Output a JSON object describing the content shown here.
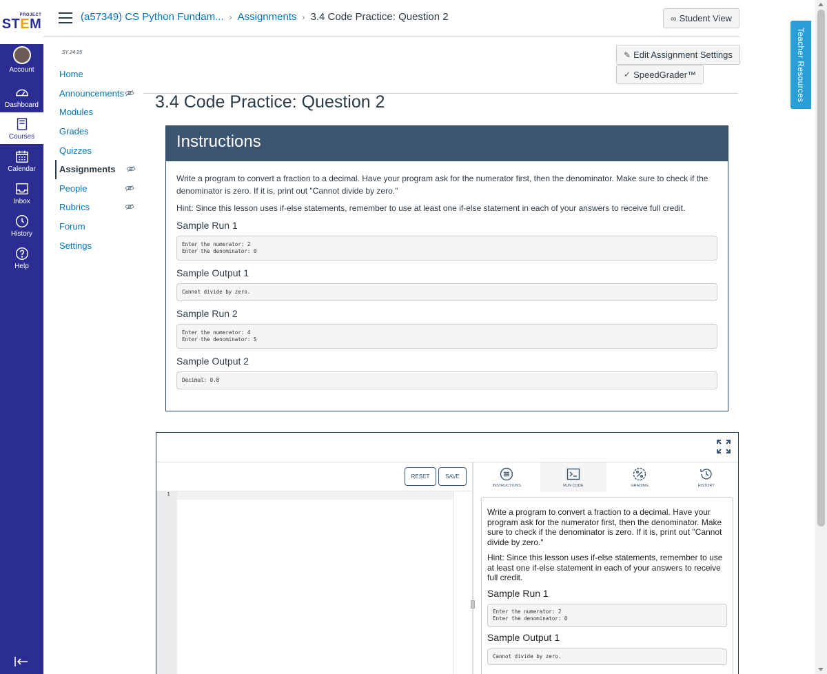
{
  "logo": {
    "line1": "PROJECT",
    "line2_a": "ST",
    "line2_b": "E",
    "line2_c": "M"
  },
  "global_nav": [
    {
      "label": "Account",
      "icon": "avatar"
    },
    {
      "label": "Dashboard",
      "icon": "dashboard-icon"
    },
    {
      "label": "Courses",
      "icon": "courses-icon"
    },
    {
      "label": "Calendar",
      "icon": "calendar-icon"
    },
    {
      "label": "Inbox",
      "icon": "inbox-icon"
    },
    {
      "label": "History",
      "icon": "clock-icon"
    },
    {
      "label": "Help",
      "icon": "help-icon"
    }
  ],
  "breadcrumbs": {
    "course": "(a57349) CS Python Fundam...",
    "section": "Assignments",
    "current": "3.4 Code Practice: Question 2"
  },
  "buttons": {
    "student_view": "Student View",
    "edit_settings": "Edit Assignment Settings",
    "speedgrader": "SpeedGrader™"
  },
  "course_nav": {
    "term": "SY 24-25",
    "items": [
      {
        "label": "Home",
        "hidden_icon": false
      },
      {
        "label": "Announcements",
        "hidden_icon": true
      },
      {
        "label": "Modules",
        "hidden_icon": false
      },
      {
        "label": "Grades",
        "hidden_icon": false
      },
      {
        "label": "Quizzes",
        "hidden_icon": false
      },
      {
        "label": "Assignments",
        "hidden_icon": true,
        "active": true
      },
      {
        "label": "People",
        "hidden_icon": true
      },
      {
        "label": "Rubrics",
        "hidden_icon": true
      },
      {
        "label": "Forum",
        "hidden_icon": false
      },
      {
        "label": "Settings",
        "hidden_icon": false
      }
    ]
  },
  "teacher_resources": "Teacher Resources",
  "page_title": "3.4 Code Practice: Question 2",
  "instructions": {
    "heading": "Instructions",
    "para1": "Write a program to convert a fraction to a decimal. Have your program ask for the numerator first, then the denominator. Make sure to check if the denominator is zero. If it is, print out \"Cannot divide by zero.\"",
    "hint": "Hint: Since this lesson uses if-else statements, remember to use at least one if-else statement in each of your answers to receive full credit.",
    "run1_title": "Sample Run 1",
    "run1_code": "Enter the numerator: 2\nEnter the denominator: 0",
    "out1_title": "Sample Output 1",
    "out1_code": "Cannot divide by zero.",
    "run2_title": "Sample Run 2",
    "run2_code": "Enter the numerator: 4\nEnter the denominator: 5",
    "out2_title": "Sample Output 2",
    "out2_code": "Decimal: 0.8"
  },
  "ide": {
    "reset": "RESET",
    "save": "SAVE",
    "line_number": "1",
    "tabs": [
      "INSTRUCTIONS",
      "RUN CODE",
      "GRADING",
      "HISTORY"
    ],
    "panel_para1": "Write a program to convert a fraction to a decimal. Have your program ask for the numerator first, then the denominator. Make sure to check if the denominator is zero. If it is, print out \"Cannot divide by zero.\"",
    "panel_hint": "Hint: Since this lesson uses if-else statements, remember to use at least one if-else statement in each of your answers to receive full credit.",
    "panel_run1_title": "Sample Run 1",
    "panel_run1_code": "Enter the numerator: 2\nEnter the denominator: 0",
    "panel_out1_title": "Sample Output 1",
    "panel_out1_code": "Cannot divide by zero."
  },
  "colors": {
    "global_nav": "#2b2d93",
    "instructions_header": "#3b5570",
    "link": "#0374b5",
    "teacher_tab": "#2a9fd6"
  }
}
